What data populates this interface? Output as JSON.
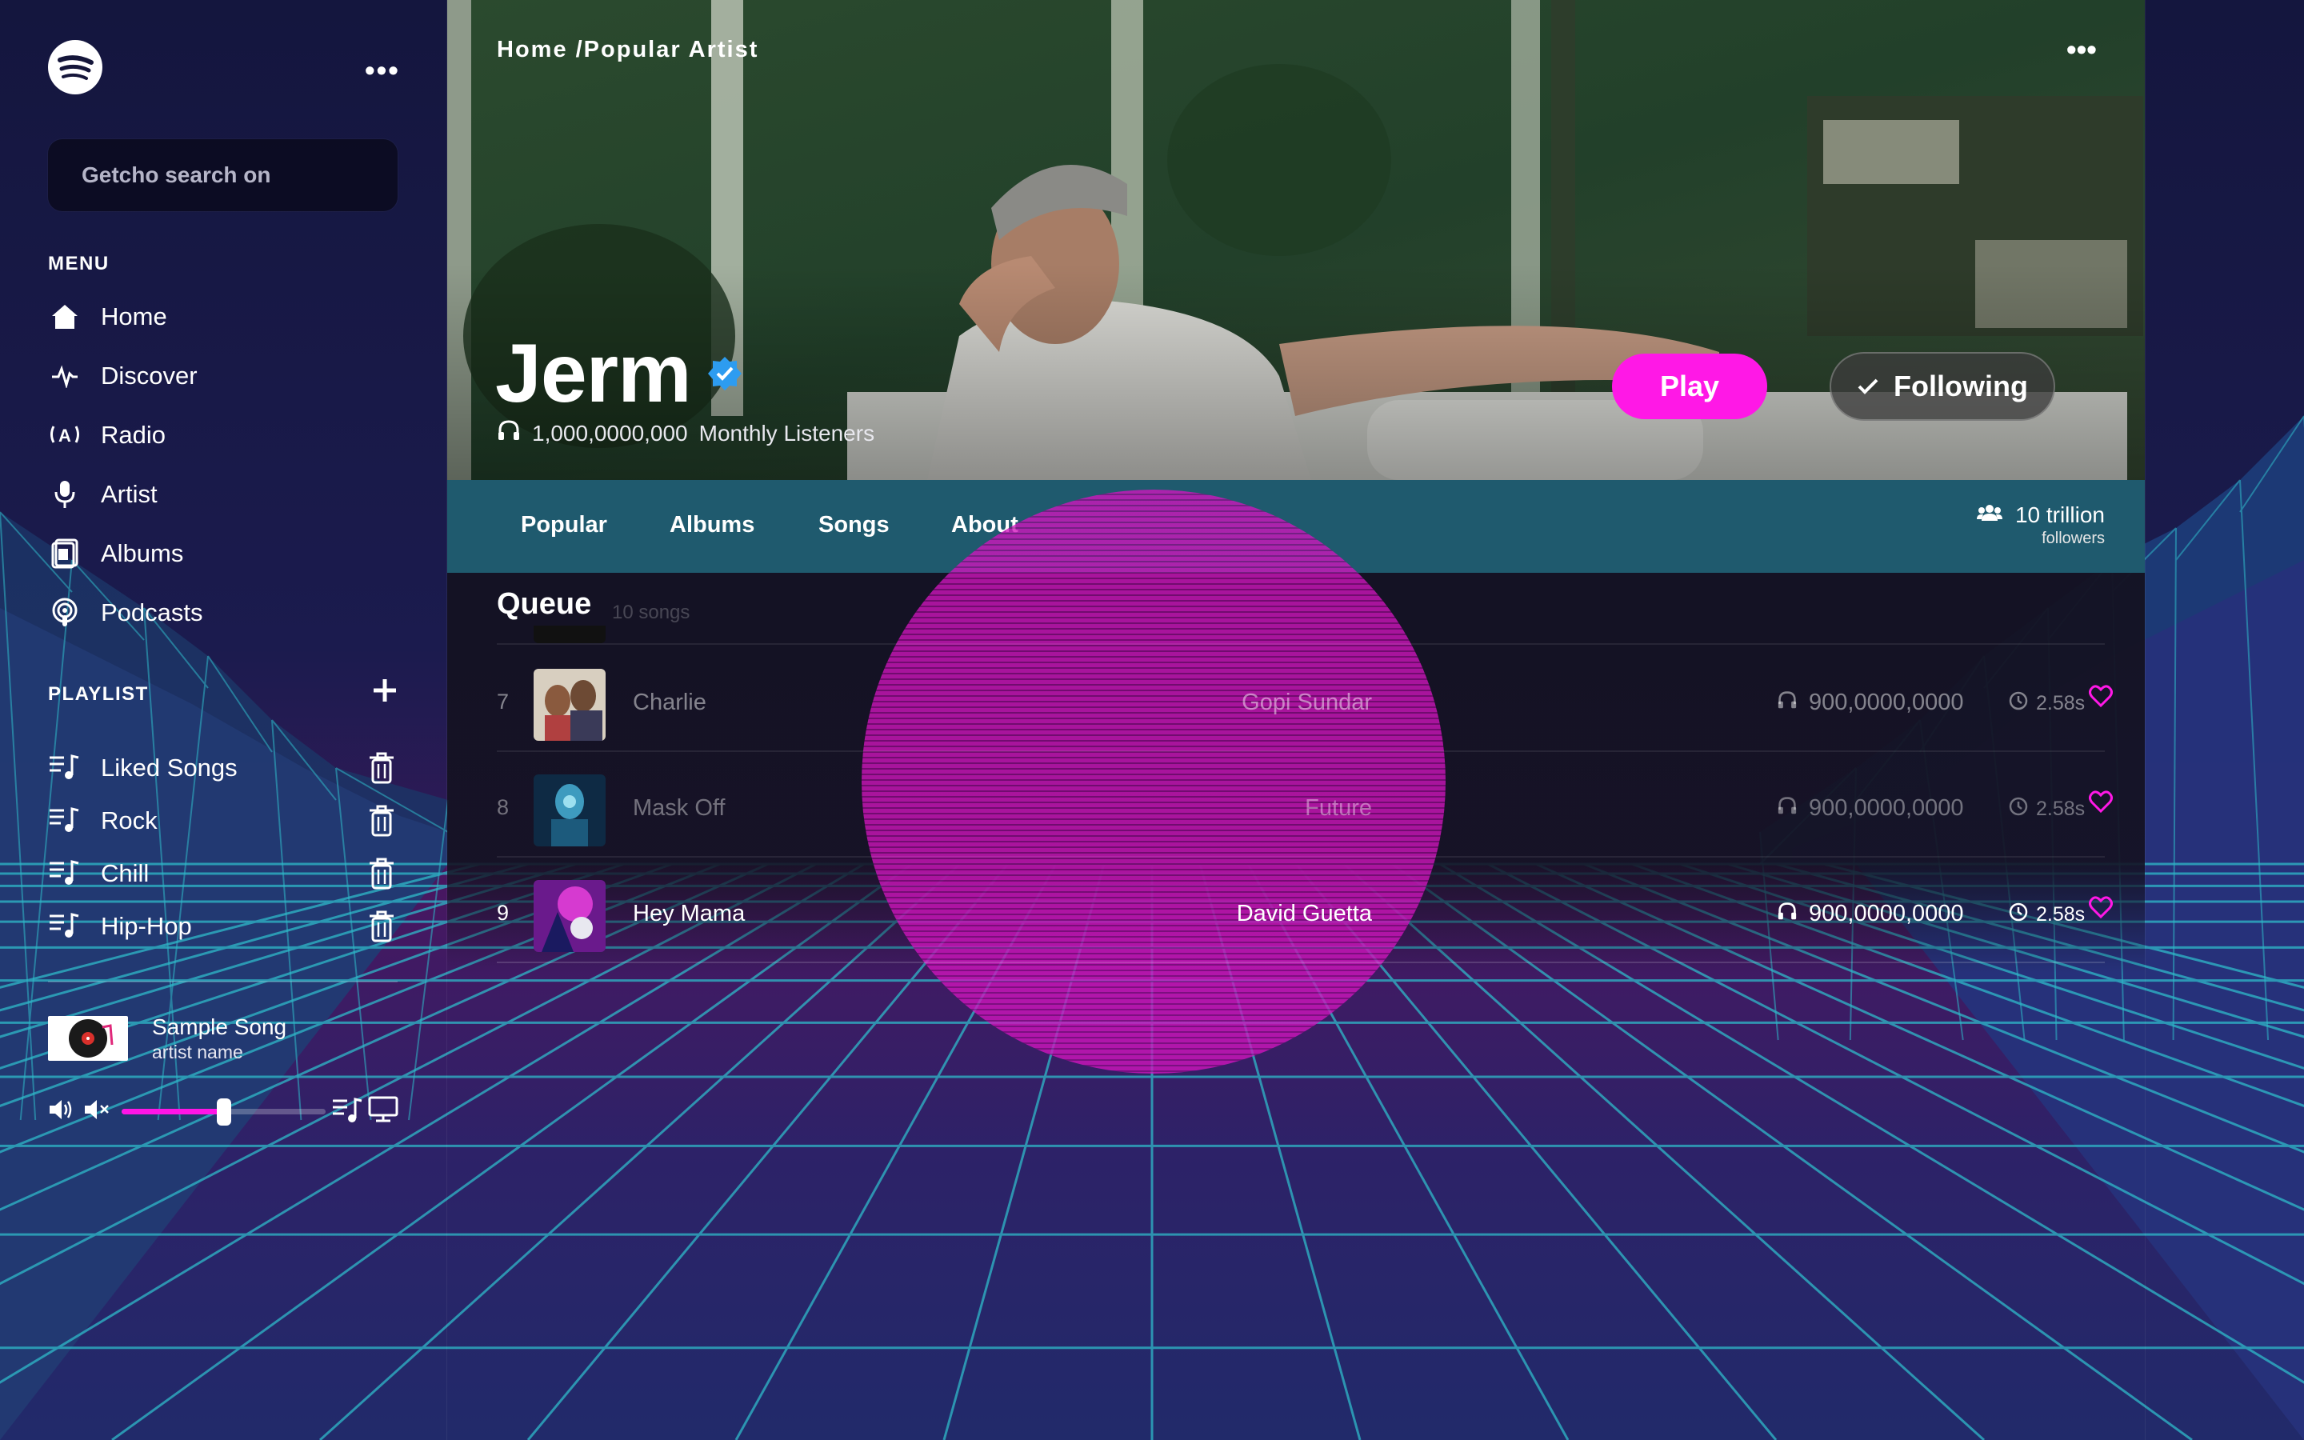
{
  "sidebar": {
    "search_placeholder": "Getcho search on",
    "menu_heading": "MENU",
    "menu_items": [
      {
        "label": "Home",
        "icon": "home-icon"
      },
      {
        "label": "Discover",
        "icon": "pulse-icon"
      },
      {
        "label": "Radio",
        "icon": "radio-icon"
      },
      {
        "label": "Artist",
        "icon": "microphone-icon"
      },
      {
        "label": "Albums",
        "icon": "album-icon"
      },
      {
        "label": "Podcasts",
        "icon": "podcast-icon"
      }
    ],
    "playlist_heading": "PLAYLIST",
    "playlists": [
      {
        "label": "Liked Songs"
      },
      {
        "label": "Rock"
      },
      {
        "label": "Chill"
      },
      {
        "label": "Hip-Hop"
      }
    ],
    "now_playing": {
      "title": "Sample Song",
      "artist": "artist name"
    },
    "volume": 0.5
  },
  "main": {
    "breadcrumb": "Home /Popular Artist",
    "artist": {
      "name": "Jerm",
      "listeners_count": "1,000,0000,000",
      "listeners_label": "Monthly Listeners"
    },
    "play_label": "Play",
    "following_label": "Following",
    "tabs": [
      {
        "label": "Popular"
      },
      {
        "label": "Albums"
      },
      {
        "label": "Songs"
      },
      {
        "label": "About"
      }
    ],
    "followers": {
      "count": "10 trillion",
      "label": "followers"
    },
    "queue": {
      "title": "Queue",
      "count": "10 songs",
      "rows": [
        {
          "num": "7",
          "title": "Charlie",
          "artist": "Gopi Sundar",
          "plays": "900,0000,0000",
          "duration": "2.58s"
        },
        {
          "num": "8",
          "title": "Mask Off",
          "artist": "Future",
          "plays": "900,0000,0000",
          "duration": "2.58s"
        },
        {
          "num": "9",
          "title": "Hey Mama",
          "artist": "David Guetta",
          "plays": "900,0000,0000",
          "duration": "2.58s"
        }
      ]
    }
  },
  "colors": {
    "accent": "#ff18e6",
    "tabbar": "#1f5a6e",
    "grid": "#2fb9c9"
  }
}
